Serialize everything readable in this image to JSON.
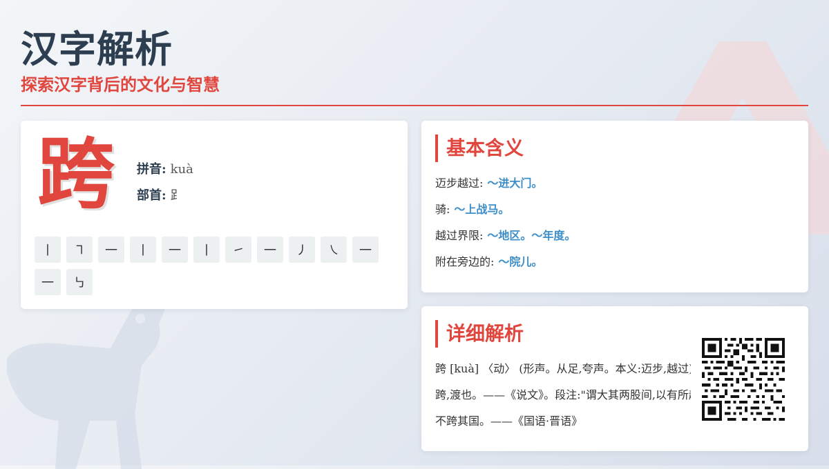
{
  "header": {
    "title": "汉字解析",
    "subtitle": "探索汉字背后的文化与智慧"
  },
  "character": {
    "glyph": "跨",
    "pinyin_label": "拼音:",
    "pinyin": "kuà",
    "radical_label": "部首:",
    "radical": "⻊",
    "strokes": [
      "丨",
      "㇕",
      "一",
      "丨",
      "一",
      "丨",
      "㇀",
      "一",
      "㇓",
      "㇏",
      "一",
      "一",
      "㇉"
    ]
  },
  "basic": {
    "heading": "基本含义",
    "items": [
      {
        "text": "迈步越过:",
        "examples": [
          "～进大门。"
        ]
      },
      {
        "text": "骑:",
        "examples": [
          "～上战马。"
        ]
      },
      {
        "text": "越过界限:",
        "examples": [
          "～地区。",
          "～年度。"
        ]
      },
      {
        "text": "附在旁边的:",
        "examples": [
          "～院儿。"
        ]
      }
    ]
  },
  "detail": {
    "heading": "详细解析",
    "lines": [
      "跨 [kuà] 〈动〉 (形声。从足,夸声。本义:迈步,越过)",
      "跨,渡也。——《说文》。段注:\"谓大其两股间,以有所越也。\"",
      "不跨其国。——《国语·晋语》"
    ]
  },
  "decor": {
    "accent_color": "#e0463d",
    "text_color": "#2c3e50",
    "example_color": "#3c8dc8",
    "icons": [
      "triangle-watermark",
      "horse-watermark",
      "qr-code"
    ]
  }
}
